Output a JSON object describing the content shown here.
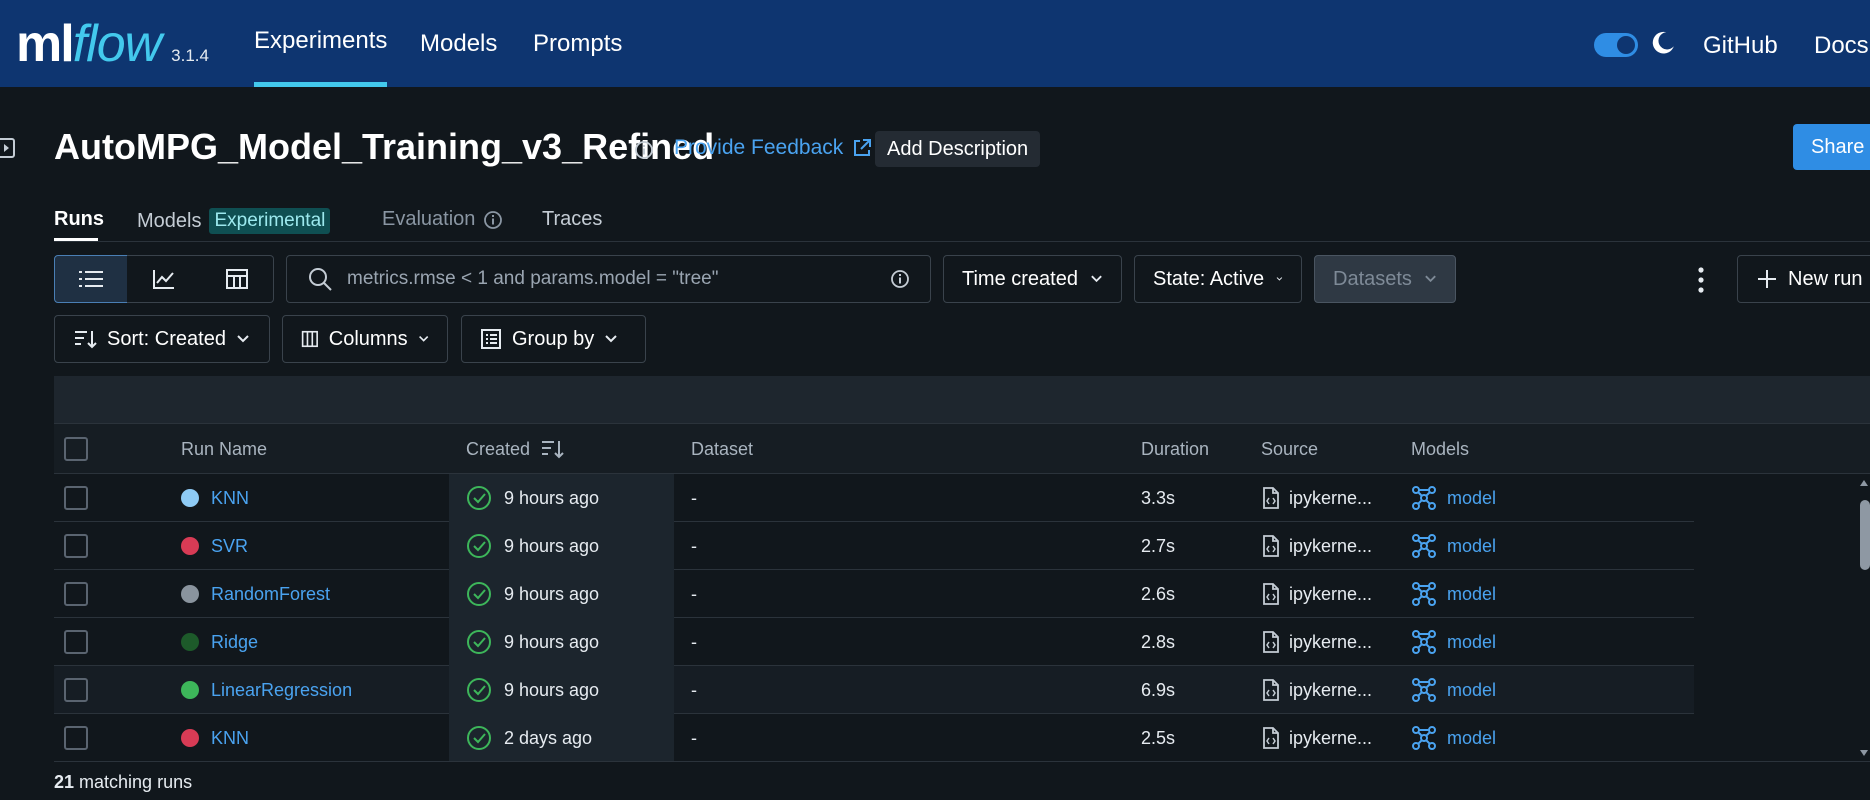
{
  "header": {
    "logo_ml": "ml",
    "logo_flow": "flow",
    "version": "3.1.4",
    "nav": [
      "Experiments",
      "Models",
      "Prompts"
    ],
    "links": [
      "GitHub",
      "Docs"
    ],
    "dark_mode_on": true
  },
  "experiment": {
    "title": "AutoMPG_Model_Training_v3_Refined",
    "feedback_label": "Provide Feedback",
    "add_description_label": "Add Description",
    "share_label": "Share"
  },
  "tabs": {
    "runs": "Runs",
    "models": "Models",
    "models_badge": "Experimental",
    "evaluation": "Evaluation",
    "traces": "Traces"
  },
  "toolbar": {
    "search_placeholder": "metrics.rmse < 1 and params.model = \"tree\"",
    "time_created": "Time created",
    "state": "State: Active",
    "datasets": "Datasets",
    "new_run": "New run",
    "sort": "Sort: Created",
    "columns": "Columns",
    "group_by": "Group by"
  },
  "table": {
    "columns": [
      "Run Name",
      "Created",
      "Dataset",
      "Duration",
      "Source",
      "Models"
    ],
    "rows": [
      {
        "name": "KNN",
        "color": "#8ecbf5",
        "created": "9 hours ago",
        "dataset": "-",
        "duration": "3.3s",
        "source": "ipykerne...",
        "model": "model"
      },
      {
        "name": "SVR",
        "color": "#d83b55",
        "created": "9 hours ago",
        "dataset": "-",
        "duration": "2.7s",
        "source": "ipykerne...",
        "model": "model"
      },
      {
        "name": "RandomForest",
        "color": "#8a949e",
        "created": "9 hours ago",
        "dataset": "-",
        "duration": "2.6s",
        "source": "ipykerne...",
        "model": "model"
      },
      {
        "name": "Ridge",
        "color": "#1d5a2a",
        "created": "9 hours ago",
        "dataset": "-",
        "duration": "2.8s",
        "source": "ipykerne...",
        "model": "model"
      },
      {
        "name": "LinearRegression",
        "color": "#3db65a",
        "created": "9 hours ago",
        "dataset": "-",
        "duration": "6.9s",
        "source": "ipykerne...",
        "model": "model"
      },
      {
        "name": "KNN",
        "color": "#d83b55",
        "created": "2 days ago",
        "dataset": "-",
        "duration": "2.5s",
        "source": "ipykerne...",
        "model": "model"
      }
    ]
  },
  "footer": {
    "count": "21",
    "label": " matching runs"
  },
  "colors": {
    "header_bg": "#0e3570",
    "accent": "#43c9ed",
    "link": "#4aa3f0",
    "primary_button": "#2f8de4",
    "success": "#3db65a"
  }
}
